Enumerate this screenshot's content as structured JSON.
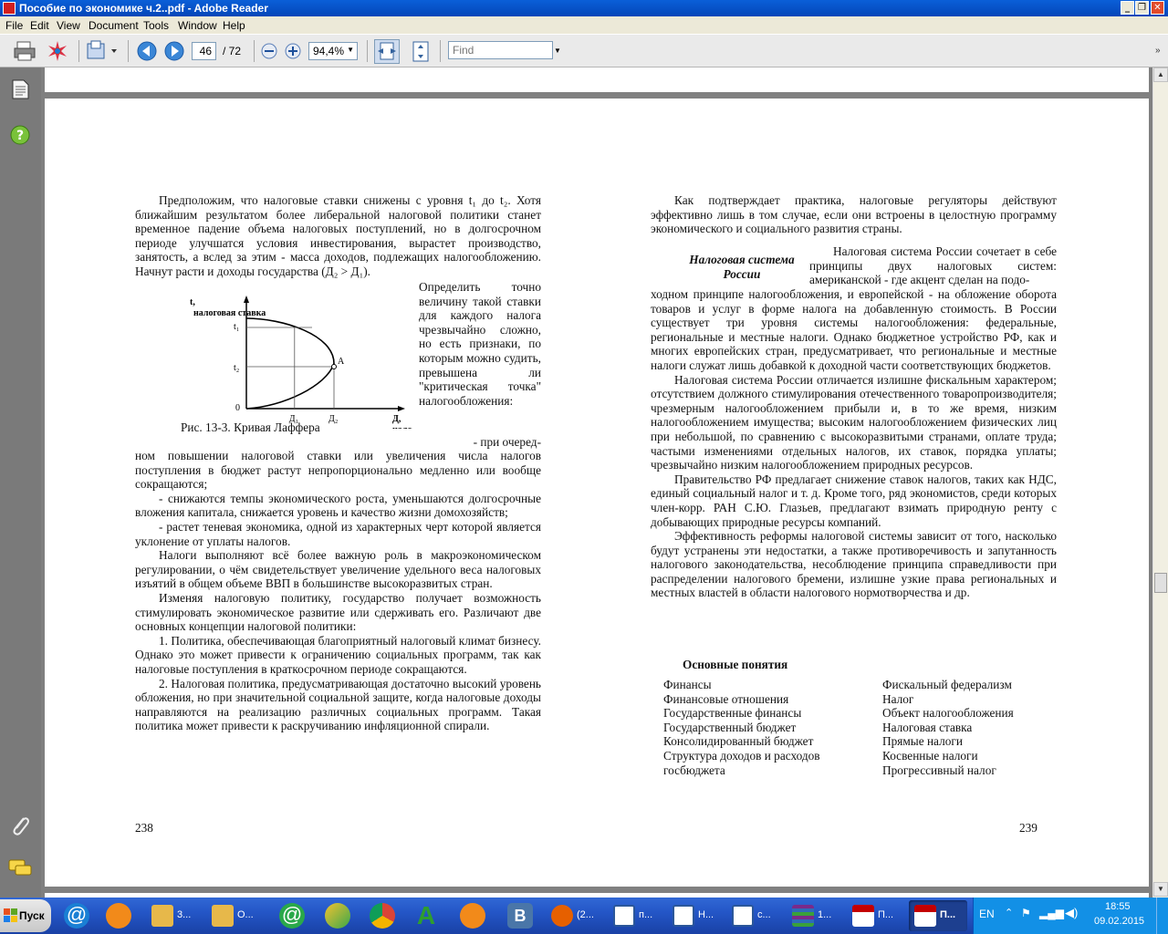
{
  "window": {
    "title": "Пособие по экономике ч.2..pdf - Adobe Reader",
    "controls": {
      "minimize": "_",
      "restore": "❐",
      "close": "✕"
    }
  },
  "menu": [
    "File",
    "Edit",
    "View",
    "Document",
    "Tools",
    "Window",
    "Help"
  ],
  "toolbar": {
    "page_current": "46",
    "page_total": "/ 72",
    "zoom": "94,4%",
    "find_placeholder": "Find"
  },
  "left_page": {
    "paragraphs_top": [
      "Предположим, что налоговые ставки снижены с уровня t₁ до t₂. Хотя ближайшим результатом более либеральной налоговой политики станет временное падение объема налоговых поступлений, но в долгосрочном периоде улучшатся условия инвестирования, вырастет производство, занятость, а вслед за этим - масса доходов, подлежащих налогообложению. Начнут расти и доходы государства (Д₂ > Д₁)."
    ],
    "side_text": "Определить точно величину такой ставки для каждого налога чрезвычайно сложно, но есть признаки, по которым можно судить, превышена ли \"критическая точка\" налогообложения:",
    "figure_caption": "Рис. 13-3. Кривая Лаффера",
    "bullet1_start": "-   при очеред-",
    "paragraphs_bottom": [
      "ном повышении налоговой ставки или увеличения числа налогов поступления в бюджет растут непропорционально медленно или вообще сокращаются;",
      "-   снижаются темпы экономического роста, уменьшаются долгосрочные вложения капитала, снижается уровень и качество жизни домохозяйств;",
      "-   растет теневая экономика, одной из характерных черт которой является уклонение от уплаты налогов.",
      "Налоги выполняют всё более важную роль в макроэкономическом регулировании, о чём свидетельствует увеличение удельного веса налоговых изъятий в общем объеме ВВП в большинстве высокоразвитых стран.",
      "Изменяя налоговую политику, государство получает возможность стимулировать экономическое развитие или сдерживать его. Различают две основных концепции налоговой политики:",
      "1. Политика, обеспечивающая благоприятный налоговый климат бизнесу. Однако это может привести к ограничению социальных программ, так как налоговые поступления в краткосрочном периоде сокращаются.",
      "2. Налоговая политика, предусматривающая достаточно высокий уровень обложения, но при значительной социальной защите, когда налоговые доходы направляются на реализацию различных социальных программ. Такая политика может привести к раскручиванию инфляционной спирали."
    ],
    "page_number": "238"
  },
  "chart_data": {
    "type": "line",
    "title": "",
    "ylabel": "t, налоговая ставка",
    "xlabel": "Д, налоговые поступления",
    "y_ticks": [
      "t₁",
      "t₂",
      "0"
    ],
    "x_ticks": [
      "Д₁",
      "Д₂"
    ],
    "point_label": "A",
    "series": [
      {
        "x": [
          0,
          0.25,
          0.45,
          0.6,
          0.6,
          0.45,
          0.25,
          0
        ],
        "y": [
          0,
          0.12,
          0.25,
          0.55,
          0.6,
          0.9,
          1.05,
          1.1
        ]
      }
    ]
  },
  "right_page": {
    "intro": "Как подтверждает практика, налоговые регуляторы действуют эффективно лишь в том случае, если они встроены в целостную программу экономического и социального развития страны.",
    "side_heading": "Налоговая система России",
    "side_text_start": "Налоговая система России сочетает в себе принципы двух налоговых систем: американской - где акцент сделан на подо-",
    "paragraphs": [
      "ходном принципе налогообложения, и европейской - на обложение оборота товаров и услуг в форме налога на добавленную стоимость. В России существует три уровня системы налогообложения: федеральные, региональные и местные налоги. Однако бюджетное устройство РФ, как и многих европейских стран, предусматривает, что региональные и местные налоги служат лишь добавкой к доходной части соответствующих бюджетов.",
      "Налоговая система России отличается излишне фискальным характером; отсутствием должного стимулирования отечественного товаропроизводителя; чрезмерным налогообложением прибыли и, в то же время, низким налогообложением имущества; высоким налогообложением физических лиц при небольшой, по сравнению с высокоразвитыми странами, оплате труда; частыми изменениями отдельных налогов, их ставок, порядка уплаты; чрезвычайно низким налогообложением природных ресурсов.",
      "Правительство РФ предлагает снижение ставок налогов, таких как НДС, единый социальный налог и т. д. Кроме того, ряд экономистов, среди которых член-корр. РАН С.Ю. Глазьев, предлагают взимать природную ренту с добывающих природные ресурсы компаний.",
      "Эффективность реформы налоговой системы зависит от того, насколько будут устранены эти недостатки, а также противоречивость и запутанность налогового законодательства, несоблюдение принципа справедливости при распределении налогового бремени, излишне узкие права региональных и местных властей в области налогового нормотворчества и др."
    ],
    "concepts_title": "Основные понятия",
    "concepts_left": [
      "Финансы",
      "Финансовые отношения",
      "Государственные финансы",
      "Государственный бюджет",
      "Консолидированный бюджет",
      "Структура доходов и расходов",
      "госбюджета"
    ],
    "concepts_right": [
      "Фискальный федерализм",
      "Налог",
      "Объект налогообложения",
      "Налоговая ставка",
      "Прямые налоги",
      "Косвенные налоги",
      "Прогрессивный налог"
    ],
    "page_number": "239"
  },
  "taskbar": {
    "start_label": "Пуск",
    "tasks": [
      {
        "label": "3...",
        "icon": "folder-icon",
        "color": "#e7b84a"
      },
      {
        "label": "О...",
        "icon": "folder-icon",
        "color": "#e7b84a"
      },
      {
        "label": "(2...",
        "icon": "firefox-icon",
        "color": "#e66000"
      },
      {
        "label": "п...",
        "icon": "word-doc-icon",
        "color": "#2b579a"
      },
      {
        "label": "Н...",
        "icon": "word-doc-icon",
        "color": "#2b579a"
      },
      {
        "label": "с...",
        "icon": "word-doc-icon",
        "color": "#2b579a"
      },
      {
        "label": "1...",
        "icon": "winrar-icon",
        "color": "#7a2a8a"
      },
      {
        "label": "П...",
        "icon": "pdf-icon",
        "color": "#c40000"
      },
      {
        "label": "П...",
        "icon": "pdf-icon",
        "color": "#c40000"
      }
    ],
    "lang": "EN",
    "time": "18:55",
    "date": "09.02.2015"
  }
}
